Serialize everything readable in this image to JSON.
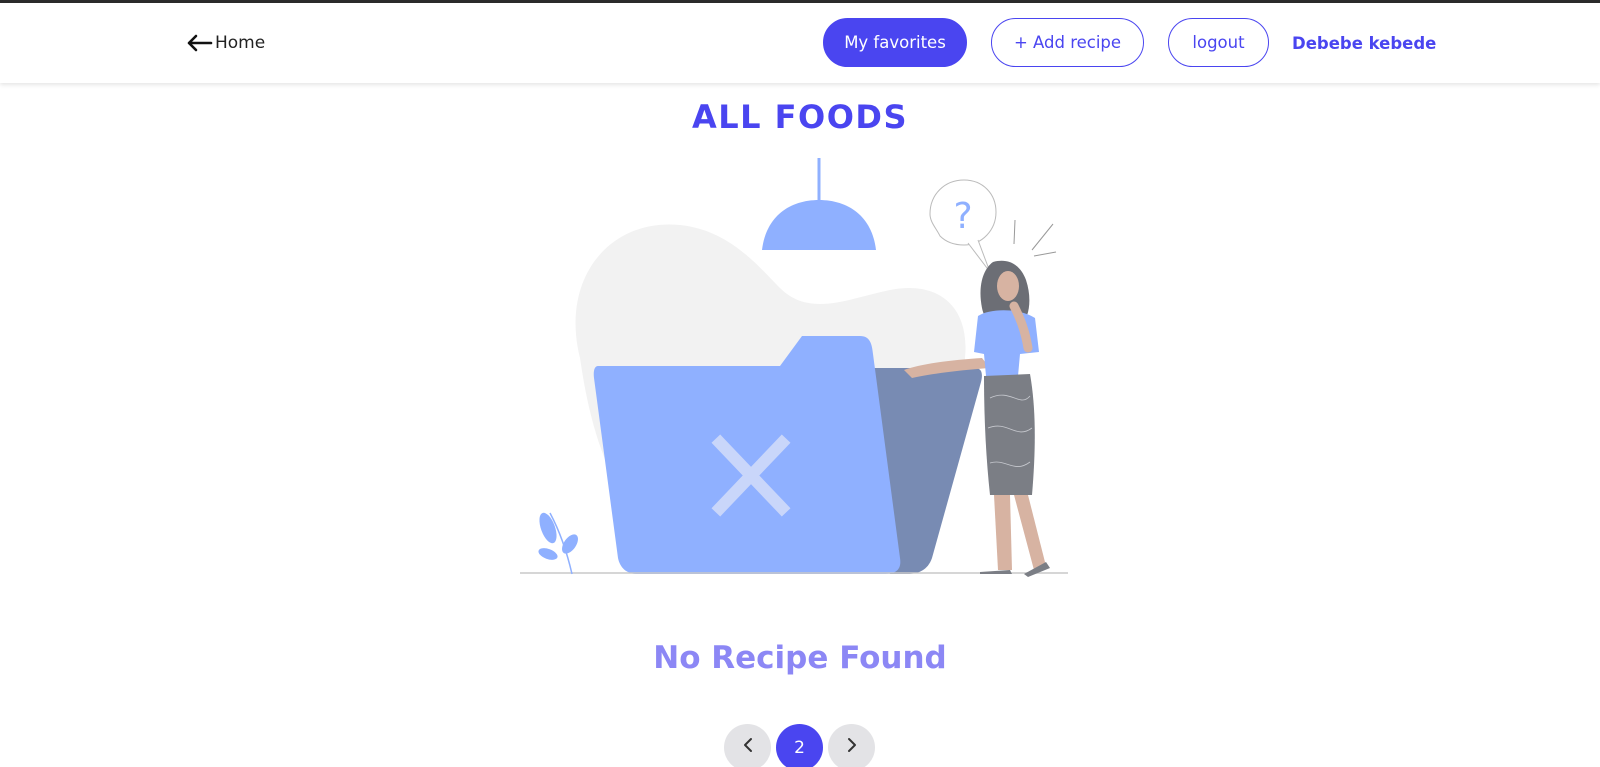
{
  "nav": {
    "home_label": "Home",
    "favorites_label": "My favorites",
    "add_recipe_label": "+ Add recipe",
    "logout_label": "logout",
    "username": "Debebe kebede"
  },
  "main": {
    "title": "ALL FOODS",
    "empty_message": "No Recipe Found"
  },
  "pagination": {
    "current_page": "2"
  },
  "colors": {
    "accent": "#4a45f0",
    "illustration_blue": "#8fb0ff",
    "empty_text": "#8c87f5"
  }
}
